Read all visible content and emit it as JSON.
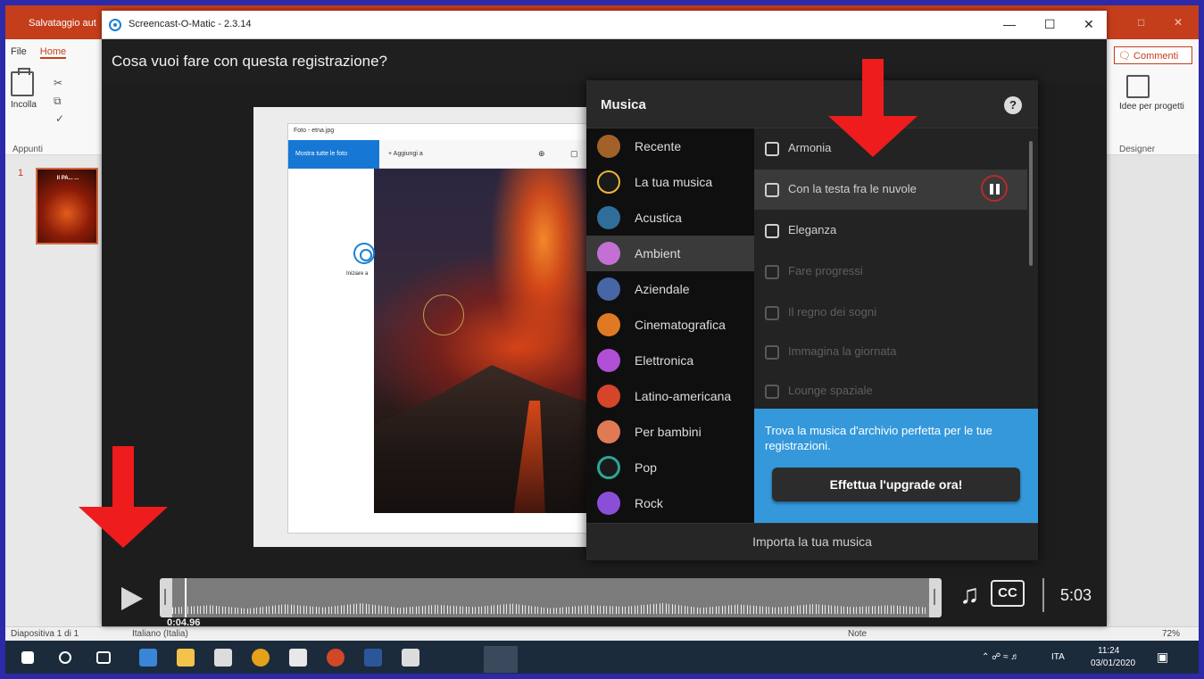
{
  "powerpoint": {
    "title_left": "Salvataggio aut",
    "tabs": [
      "File",
      "Home"
    ],
    "paste_label": "Incolla",
    "group_label": "Appunti",
    "slide_number": "1",
    "slide_thumb_text": "Il PA... ...",
    "comments_label": "Commenti",
    "design_label": "Idee per progetti",
    "designer_group": "Designer",
    "status": {
      "slide": "Diapositiva 1 di 1",
      "language": "Italiano (Italia)",
      "notes": "Note",
      "zoom": "72%"
    },
    "taskbar": {
      "lang": "ITA",
      "time": "11:24",
      "date": "03/01/2020"
    }
  },
  "som": {
    "title": "Screencast-O-Matic - 2.3.14",
    "question": "Cosa vuoi fare con questa registrazione?",
    "preview": {
      "photos_title": "Foto - etna.jpg",
      "view_all": "Mostra tutte le foto",
      "add_to": "Aggiungi a",
      "rec_label": "Iniziare a"
    },
    "music": {
      "title": "Musica",
      "help": "?",
      "categories": [
        {
          "label": "Recente",
          "icon": "clock-icon",
          "color": "#a3612a"
        },
        {
          "label": "La tua musica",
          "icon": "note-icon",
          "color": "#b57d2a"
        },
        {
          "label": "Acustica",
          "icon": "guitar-icon",
          "color": "#2f6e9a"
        },
        {
          "label": "Ambient",
          "icon": "ambient-icon",
          "color": "#c46fd4"
        },
        {
          "label": "Aziendale",
          "icon": "briefcase-icon",
          "color": "#4666a6"
        },
        {
          "label": "Cinematografica",
          "icon": "film-icon",
          "color": "#e07a22"
        },
        {
          "label": "Elettronica",
          "icon": "electronic-icon",
          "color": "#b04fd6"
        },
        {
          "label": "Latino-americana",
          "icon": "latin-icon",
          "color": "#d6442a"
        },
        {
          "label": "Per bambini",
          "icon": "kids-icon",
          "color": "#e07a55"
        },
        {
          "label": "Pop",
          "icon": "pop-icon",
          "color": "#2aa69a"
        },
        {
          "label": "Rock",
          "icon": "rock-icon",
          "color": "#8a4fd6"
        }
      ],
      "active_category": "Ambient",
      "tracks": [
        {
          "label": "Armonia",
          "dim": false
        },
        {
          "label": "Con la testa fra le nuvole",
          "dim": false
        },
        {
          "label": "Eleganza",
          "dim": false
        },
        {
          "label": "Fare progressi",
          "dim": true
        },
        {
          "label": "Il regno dei sogni",
          "dim": true
        },
        {
          "label": "Immagina la giornata",
          "dim": true
        },
        {
          "label": "Lounge spaziale",
          "dim": true
        }
      ],
      "playing_track": "Con la testa fra le nuvole",
      "promo_text": "Trova la musica d'archivio perfetta per le tue registrazioni.",
      "upgrade_label": "Effettua l'upgrade ora!",
      "import_label": "Importa la tua musica"
    },
    "player": {
      "current_time": "0:04.96",
      "duration": "5:03",
      "cc_label": "CC"
    }
  }
}
